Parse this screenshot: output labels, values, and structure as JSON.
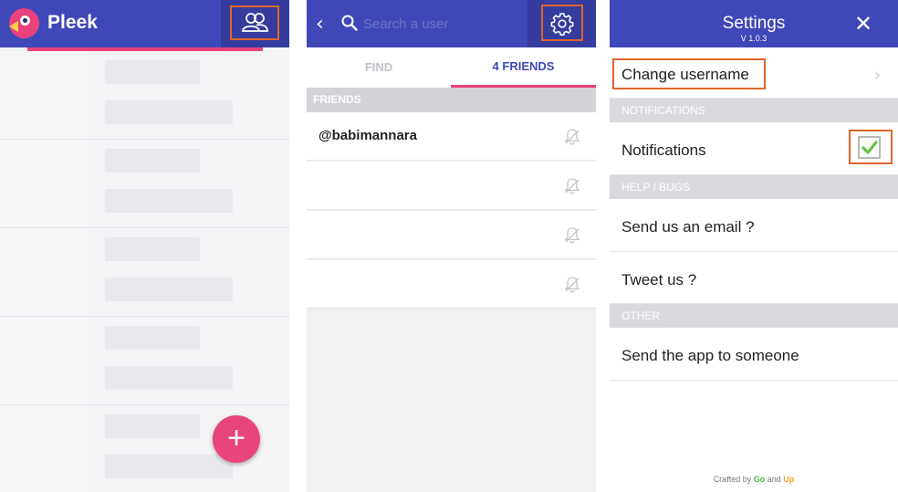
{
  "panel_home": {
    "app_title": "Pleek",
    "fab_label": "+",
    "friends_icon": "friends-icon"
  },
  "panel_friends": {
    "search_placeholder": "Search a user",
    "tabs": [
      {
        "label": "FIND",
        "active": false
      },
      {
        "label": "4 FRIENDS",
        "active": true
      }
    ],
    "section_label": "FRIENDS",
    "friends": [
      {
        "name": "@babimannara"
      },
      {
        "name": ""
      },
      {
        "name": ""
      },
      {
        "name": ""
      }
    ]
  },
  "panel_settings": {
    "title": "Settings",
    "version": "V 1.0.3",
    "change_username": "Change username",
    "notifications_header": "NOTIFICATIONS",
    "notifications_label": "Notifications",
    "notifications_checked": true,
    "help_header": "HELP / BUGS",
    "email_label": "Send us an email ?",
    "tweet_label": "Tweet us ?",
    "other_header": "OTHER",
    "share_label": "Send the app to someone",
    "footer_prefix": "Crafted by",
    "footer_go": "Go",
    "footer_and": "and",
    "footer_up": "Up"
  },
  "colors": {
    "primary": "#3f48b8",
    "primary_dark": "#353c9e",
    "accent_pink": "#e8417c",
    "highlight_orange": "#e0652b",
    "check_green": "#6cc04a"
  }
}
